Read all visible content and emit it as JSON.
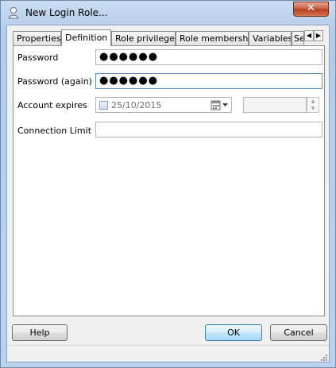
{
  "window": {
    "title": "New Login Role...",
    "close_glyph": "✕"
  },
  "tabs": [
    {
      "label": "Properties"
    },
    {
      "label": "Definition"
    },
    {
      "label": "Role privileges"
    },
    {
      "label": "Role membership"
    },
    {
      "label": "Variables"
    },
    {
      "label": "Se"
    }
  ],
  "tab_scroll": {
    "left": "◀",
    "right": "▶"
  },
  "form": {
    "password_label": "Password",
    "password_value": "●●●●●●",
    "password_again_label": "Password (again)",
    "password_again_value": "●●●●●●",
    "account_expires_label": "Account expires",
    "account_expires_date": "25/10/2015",
    "connection_limit_label": "Connection Limit",
    "connection_limit_value": ""
  },
  "spin": {
    "up": "▲",
    "down": "▼"
  },
  "buttons": {
    "help": "Help",
    "ok": "OK",
    "cancel": "Cancel"
  },
  "colors": {
    "accent": "#5a8fc9",
    "close": "#c75a3f"
  },
  "icons": {
    "title": "user-icon",
    "calendar": "calendar-icon",
    "grip": "resize-grip-icon"
  }
}
